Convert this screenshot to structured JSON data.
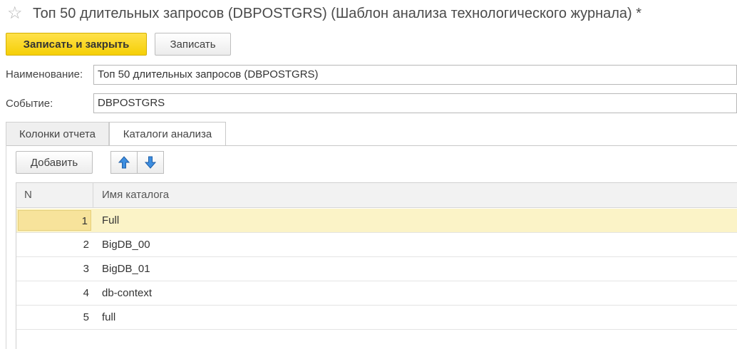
{
  "window": {
    "title": "Топ 50 длительных запросов (DBPOSTGRS) (Шаблон анализа технологического журнала) *",
    "favorite_icon": "star-outline-icon"
  },
  "toolbar": {
    "save_close_label": "Записать и закрыть",
    "save_label": "Записать"
  },
  "form": {
    "name_label": "Наименование:",
    "name_value": "Топ 50 длительных запросов (DBPOSTGRS)",
    "event_label": "Событие:",
    "event_value": "DBPOSTGRS"
  },
  "tabs": [
    {
      "label": "Колонки отчета",
      "active": false
    },
    {
      "label": "Каталоги анализа",
      "active": true
    }
  ],
  "catalog_toolbar": {
    "add_label": "Добавить",
    "up_icon": "arrow-up-icon",
    "down_icon": "arrow-down-icon"
  },
  "table": {
    "columns": [
      "N",
      "Имя каталога"
    ],
    "rows": [
      {
        "n": "1",
        "name": "Full",
        "selected": true
      },
      {
        "n": "2",
        "name": "BigDB_00",
        "selected": false
      },
      {
        "n": "3",
        "name": "BigDB_01",
        "selected": false
      },
      {
        "n": "4",
        "name": "db-context",
        "selected": false
      },
      {
        "n": "5",
        "name": "full",
        "selected": false
      }
    ]
  },
  "colors": {
    "primary_button": "#f5cf06",
    "selected_row": "#fbf3c7",
    "arrow_blue": "#2f7fd1"
  }
}
